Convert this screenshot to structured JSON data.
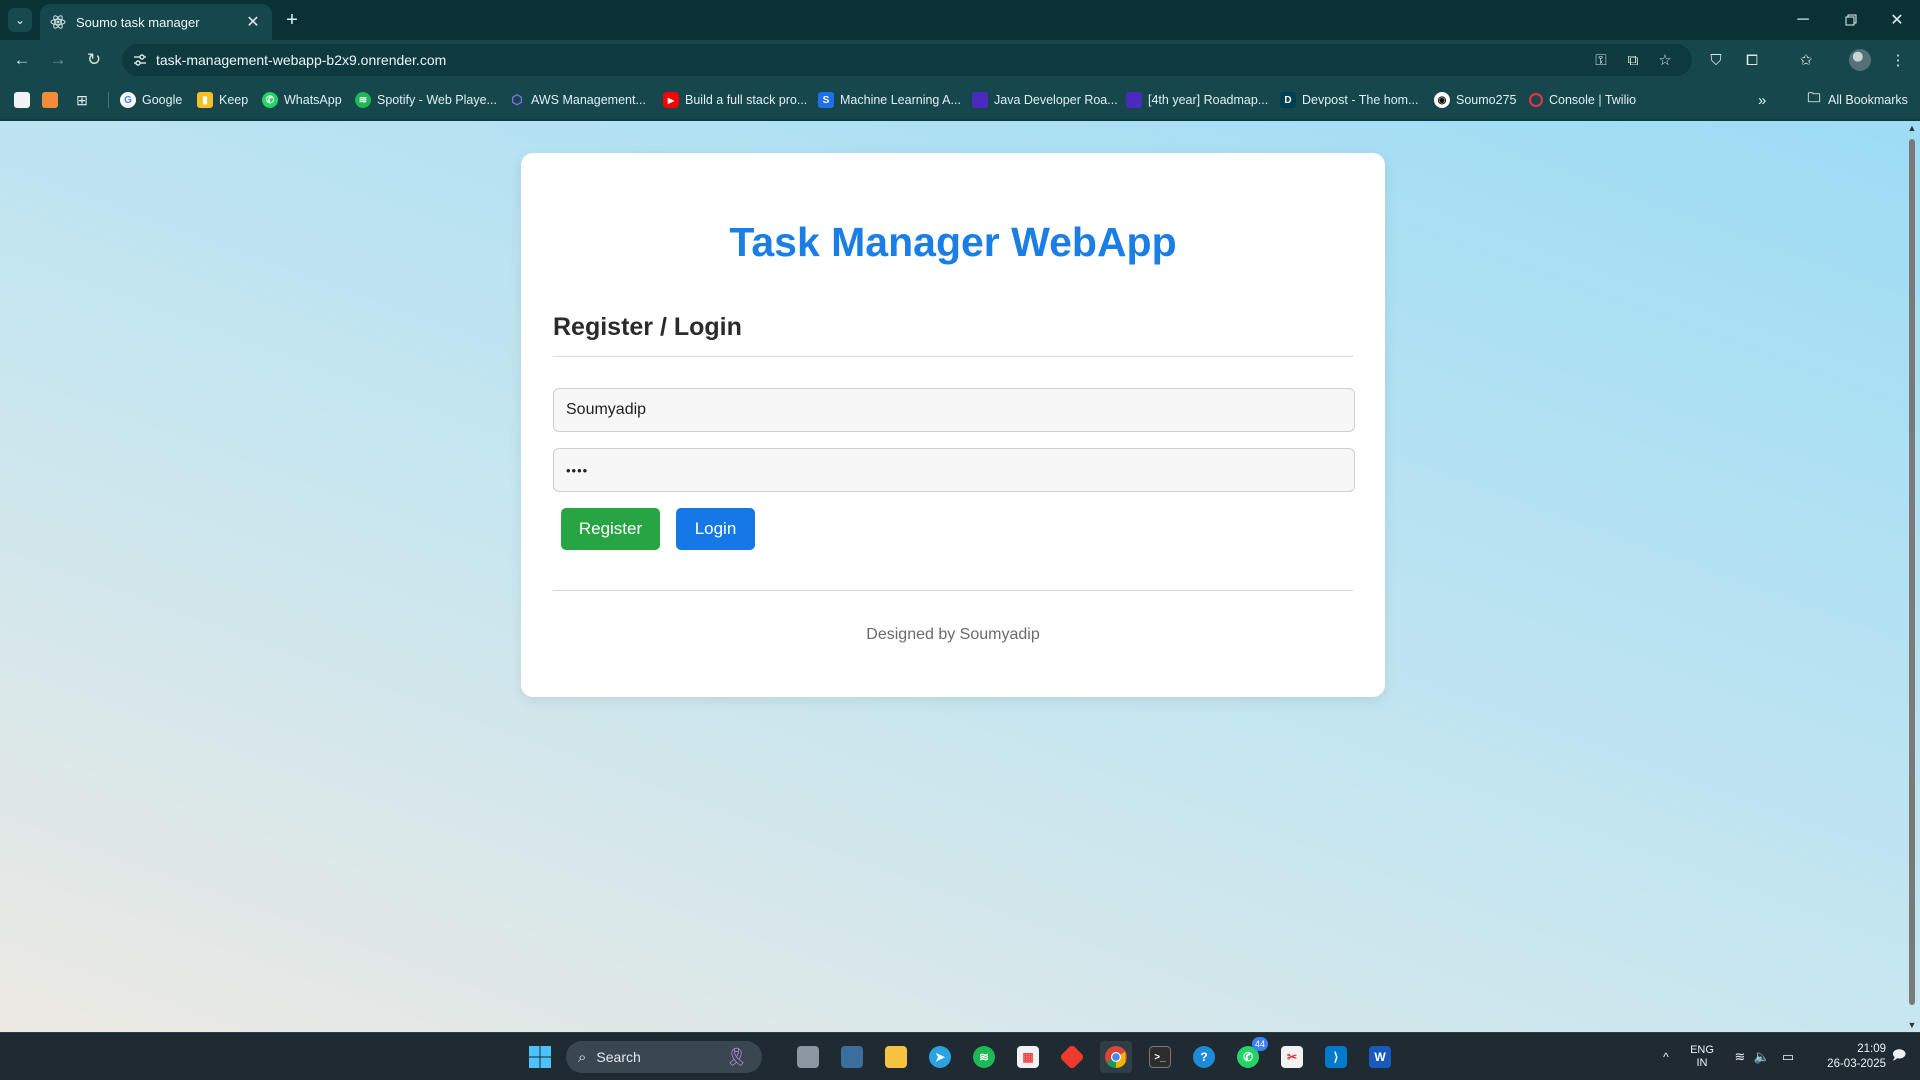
{
  "browser": {
    "tab_title": "Soumo task manager",
    "url": "task-management-webapp-b2x9.onrender.com",
    "bookmarks": [
      {
        "label": "Google",
        "icon": "google-icon",
        "color": "#ffffff"
      },
      {
        "label": "Keep",
        "icon": "keep-icon",
        "color": "#f6bf26"
      },
      {
        "label": "WhatsApp",
        "icon": "whatsapp-icon",
        "color": "#25d366"
      },
      {
        "label": "Spotify - Web Playe...",
        "icon": "spotify-icon",
        "color": "#1db954"
      },
      {
        "label": "AWS Management...",
        "icon": "aws-cube-icon",
        "color": "#8c6cf0"
      },
      {
        "label": "Build a full stack pro...",
        "icon": "youtube-icon",
        "color": "#ff0000"
      },
      {
        "label": "Machine Learning A...",
        "icon": "s-icon",
        "color": "#1f6feb"
      },
      {
        "label": "Java Developer Roa...",
        "icon": "roadmap-icon",
        "color": "#4b2bbf"
      },
      {
        "label": "[4th year] Roadmap...",
        "icon": "roadmap-icon",
        "color": "#4b2bbf"
      },
      {
        "label": "Devpost - The hom...",
        "icon": "devpost-icon",
        "color": "#003e54"
      },
      {
        "label": "Soumo275",
        "icon": "github-icon",
        "color": "#ffffff"
      },
      {
        "label": "Console | Twilio",
        "icon": "twilio-icon",
        "color": "#f22f46"
      }
    ],
    "bookmarks_overflow": "»",
    "all_bookmarks": "All Bookmarks"
  },
  "page": {
    "app_title": "Task Manager WebApp",
    "section_title": "Register / Login",
    "username_value": "Soumyadip",
    "password_value": "••••",
    "register_label": "Register",
    "login_label": "Login",
    "footer": "Designed by Soumyadip"
  },
  "taskbar": {
    "search_label": "Search",
    "whatsapp_badge": "44",
    "lang_top": "ENG",
    "lang_bottom": "IN",
    "time": "21:09",
    "date": "26-03-2025"
  },
  "colors": {
    "accent_blue": "#1a7ee4",
    "register_green": "#27a443",
    "login_blue": "#1677e6"
  }
}
